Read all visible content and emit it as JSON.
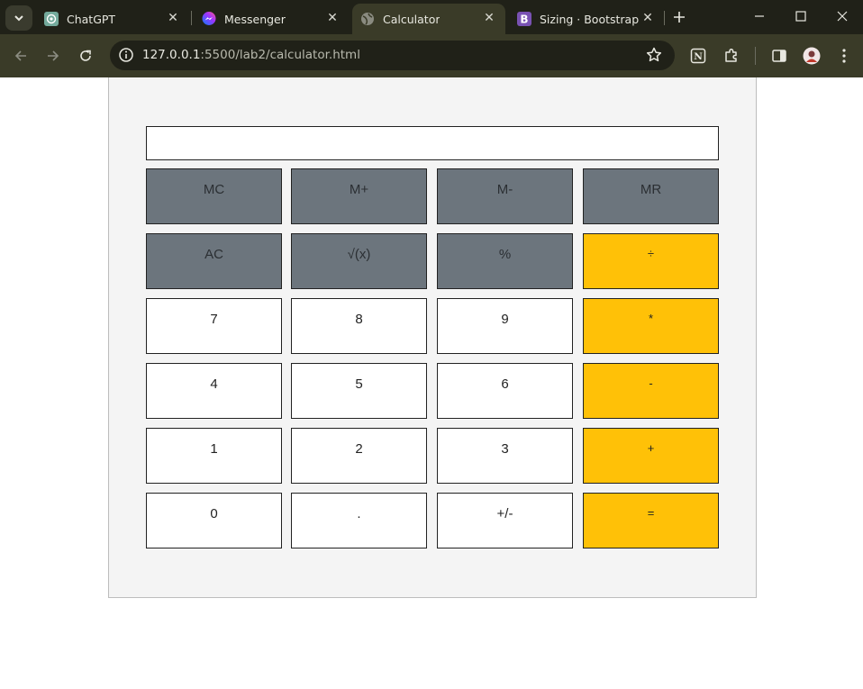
{
  "browser": {
    "tabs": [
      {
        "title": "ChatGPT",
        "favicon": "chatgpt-icon",
        "active": false
      },
      {
        "title": "Messenger",
        "favicon": "messenger-icon",
        "active": false
      },
      {
        "title": "Calculator",
        "favicon": "globe-icon",
        "active": true
      },
      {
        "title": "Sizing · Bootstrap",
        "favicon": "bootstrap-icon",
        "active": false
      }
    ],
    "url_host": "127.0.0.1",
    "url_rest": ":5500/lab2/calculator.html"
  },
  "calculator": {
    "display_value": "",
    "rows": [
      [
        {
          "label": "MC",
          "style": "gray"
        },
        {
          "label": "M+",
          "style": "gray"
        },
        {
          "label": "M-",
          "style": "gray"
        },
        {
          "label": "MR",
          "style": "gray"
        }
      ],
      [
        {
          "label": "AC",
          "style": "gray"
        },
        {
          "label": "√(x)",
          "style": "gray"
        },
        {
          "label": "%",
          "style": "gray"
        },
        {
          "label": "÷",
          "style": "yellow"
        }
      ],
      [
        {
          "label": "7",
          "style": "white"
        },
        {
          "label": "8",
          "style": "white"
        },
        {
          "label": "9",
          "style": "white"
        },
        {
          "label": "*",
          "style": "yellow"
        }
      ],
      [
        {
          "label": "4",
          "style": "white"
        },
        {
          "label": "5",
          "style": "white"
        },
        {
          "label": "6",
          "style": "white"
        },
        {
          "label": "-",
          "style": "yellow"
        }
      ],
      [
        {
          "label": "1",
          "style": "white"
        },
        {
          "label": "2",
          "style": "white"
        },
        {
          "label": "3",
          "style": "white"
        },
        {
          "label": "+",
          "style": "yellow"
        }
      ],
      [
        {
          "label": "0",
          "style": "white"
        },
        {
          "label": ".",
          "style": "white"
        },
        {
          "label": "+/-",
          "style": "white"
        },
        {
          "label": "=",
          "style": "yellow"
        }
      ]
    ]
  },
  "colors": {
    "gray_key": "#6c757d",
    "yellow_key": "#ffc107",
    "white_key": "#ffffff",
    "panel": "#f4f4f4",
    "chrome_frame": "#202118",
    "chrome_toolbar": "#3a3b28"
  }
}
